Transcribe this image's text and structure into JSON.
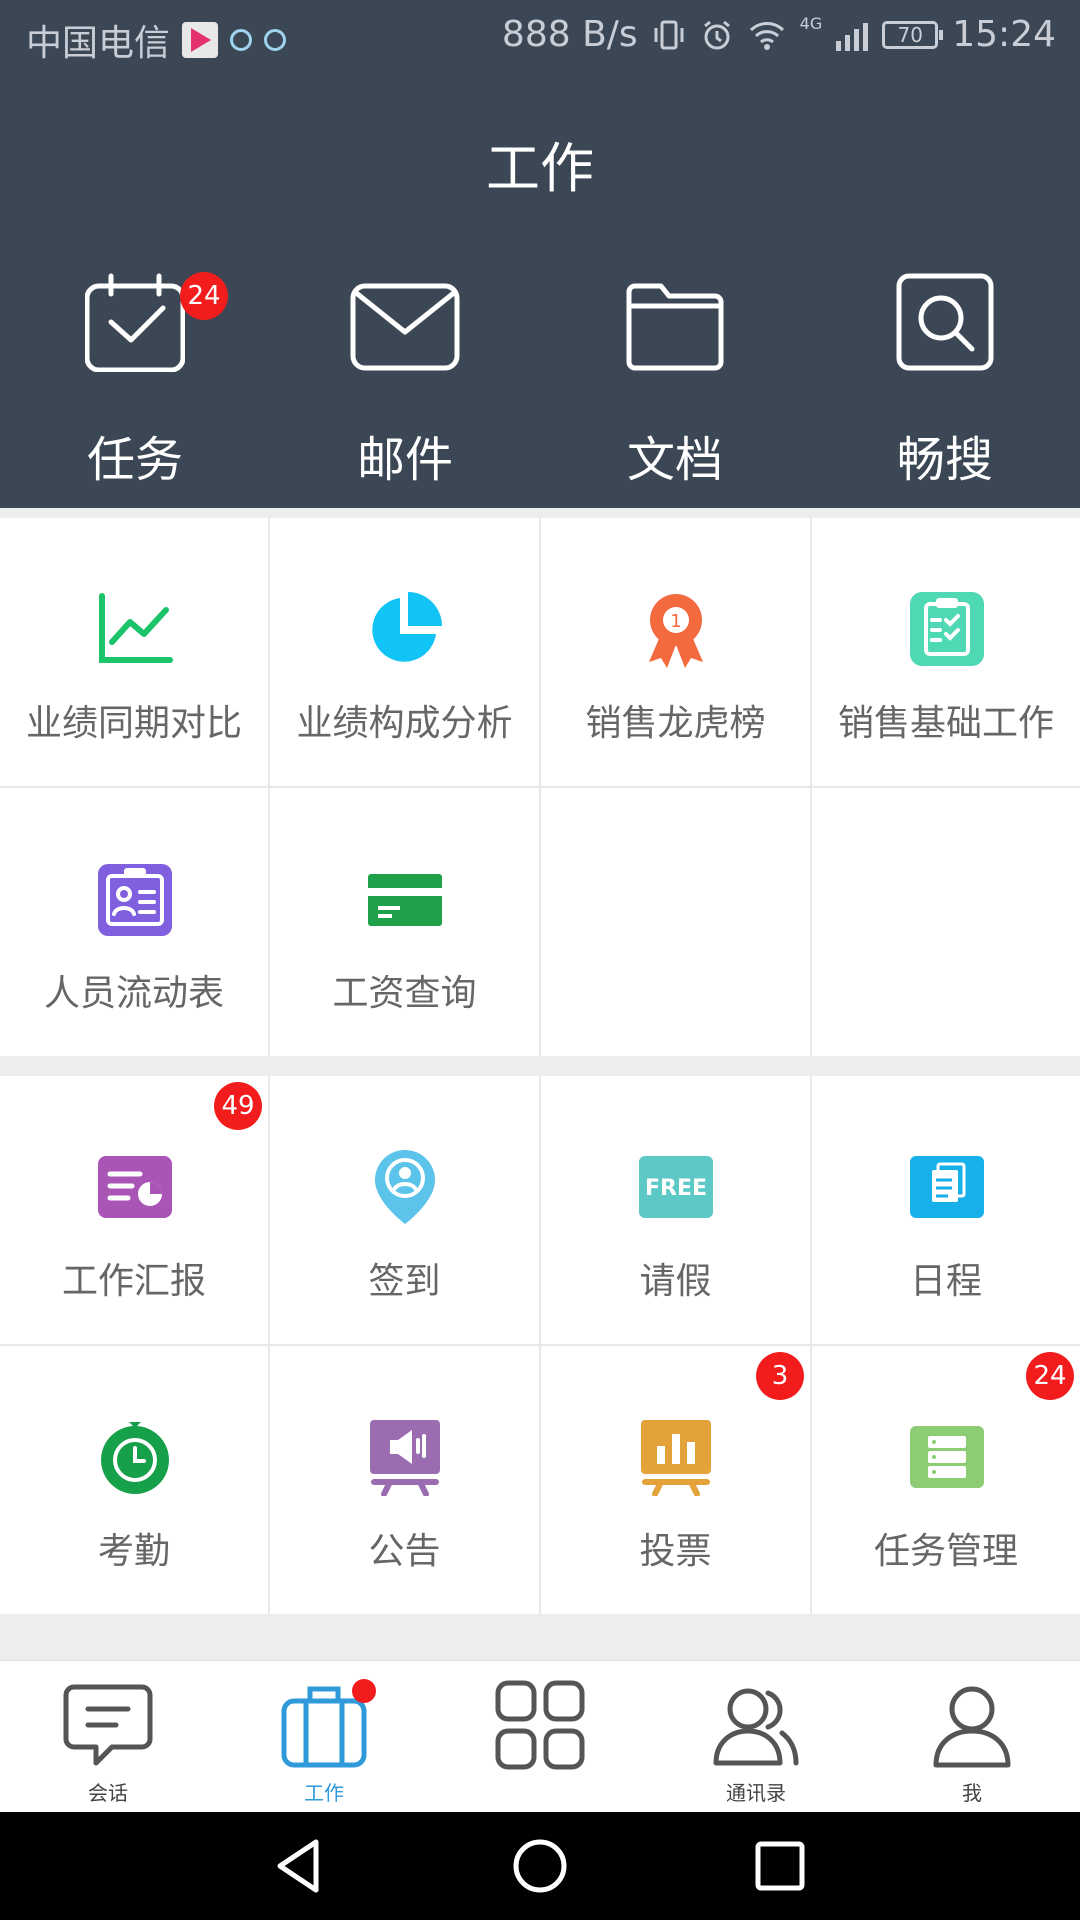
{
  "status_bar": {
    "carrier": "中国电信",
    "net_speed": "888 B/s",
    "network_type": "4G",
    "battery": "70",
    "time": "15:24"
  },
  "header": {
    "title": "工作"
  },
  "top_actions": [
    {
      "label": "任务",
      "icon": "calendar-check-icon",
      "badge": "24"
    },
    {
      "label": "邮件",
      "icon": "envelope-icon"
    },
    {
      "label": "文档",
      "icon": "folder-icon"
    },
    {
      "label": "畅搜",
      "icon": "search-icon"
    }
  ],
  "grid1": [
    {
      "label": "业绩同期对比",
      "icon": "line-chart-icon",
      "color": "#1bc46a"
    },
    {
      "label": "业绩构成分析",
      "icon": "pie-chart-icon",
      "color": "#12c4f5"
    },
    {
      "label": "销售龙虎榜",
      "icon": "ribbon-medal-icon",
      "color": "#f26a3e"
    },
    {
      "label": "销售基础工作",
      "icon": "clipboard-check-icon",
      "color": "#4fd8b4"
    },
    {
      "label": "人员流动表",
      "icon": "id-badge-icon",
      "color": "#8160e0"
    },
    {
      "label": "工资查询",
      "icon": "credit-card-icon",
      "color": "#1fa14a"
    }
  ],
  "grid2": [
    {
      "label": "工作汇报",
      "icon": "report-icon",
      "color": "#a855b5",
      "badge": "49"
    },
    {
      "label": "签到",
      "icon": "location-pin-icon",
      "color": "#5cc3ea"
    },
    {
      "label": "请假",
      "icon": "free-tag-icon",
      "color": "#5cc9c7",
      "tag": "FREE"
    },
    {
      "label": "日程",
      "icon": "schedule-doc-icon",
      "color": "#17b0ea"
    },
    {
      "label": "考勤",
      "icon": "clock-icon",
      "color": "#16a04a"
    },
    {
      "label": "公告",
      "icon": "megaphone-board-icon",
      "color": "#9b6db0"
    },
    {
      "label": "投票",
      "icon": "bar-chart-board-icon",
      "color": "#e3a33a",
      "badge": "3"
    },
    {
      "label": "任务管理",
      "icon": "server-list-icon",
      "color": "#8bcc74",
      "badge": "24"
    }
  ],
  "bottom_nav": [
    {
      "label": "会话",
      "icon": "chat-bubble-icon"
    },
    {
      "label": "工作",
      "icon": "briefcase-icon",
      "active": true
    },
    {
      "label": "",
      "icon": "app-grid-icon"
    },
    {
      "label": "通讯录",
      "icon": "contacts-icon"
    },
    {
      "label": "我",
      "icon": "user-icon"
    }
  ],
  "colors": {
    "header_bg": "#3c4755",
    "accent": "#2f9ad9",
    "badge": "#f31c1c"
  }
}
